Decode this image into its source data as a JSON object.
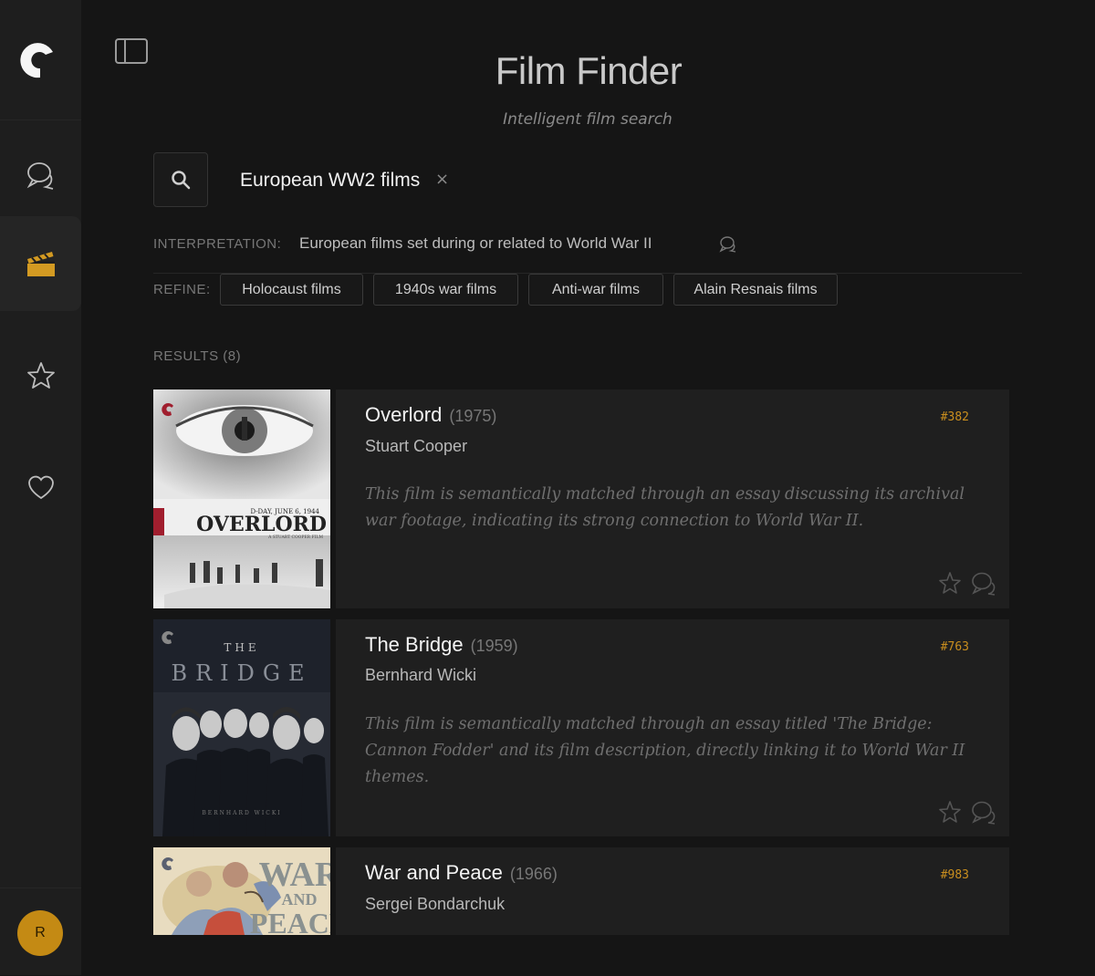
{
  "app": {
    "title": "Film Finder",
    "subtitle": "Intelligent film search"
  },
  "sidebar": {
    "logo": "criterion-c-logo",
    "items": [
      {
        "name": "chat",
        "icon": "chat-bubble-icon",
        "active": false
      },
      {
        "name": "films",
        "icon": "clapperboard-icon",
        "active": true
      },
      {
        "name": "favorites",
        "icon": "star-icon",
        "active": false
      },
      {
        "name": "liked",
        "icon": "heart-icon",
        "active": false
      }
    ],
    "avatar_initial": "R",
    "avatar_color": "#c48a14"
  },
  "search": {
    "query": "European WW2 films",
    "clear_symbol": "×"
  },
  "interpretation": {
    "label": "INTERPRETATION:",
    "text": "European films set during or related to World War II"
  },
  "refine": {
    "label": "REFINE:",
    "chips": [
      "Holocaust films",
      "1940s war films",
      "Anti-war films",
      "Alain Resnais films"
    ]
  },
  "results": {
    "label": "RESULTS (8)",
    "items": [
      {
        "title": "Overlord",
        "year": "(1975)",
        "director": "Stuart Cooper",
        "rank": "#382",
        "description": "This film is semantically matched through an essay discussing its archival war footage, indicating its strong connection to World War II.",
        "poster_text": "OVERLORD",
        "poster_tagline": "D-DAY, JUNE 6, 1944",
        "poster_credit": "A STUART COOPER FILM"
      },
      {
        "title": "The Bridge",
        "year": "(1959)",
        "director": "Bernhard Wicki",
        "rank": "#763",
        "description": "This film is semantically matched through an essay titled 'The Bridge: Cannon Fodder' and its film description, directly linking it to World War II themes.",
        "poster_the": "THE",
        "poster_text": "BRIDGE",
        "poster_credit": "BERNHARD WICKI"
      },
      {
        "title": "War and Peace",
        "year": "(1966)",
        "director": "Sergei Bondarchuk",
        "rank": "#983",
        "poster_text_1": "WAR",
        "poster_text_2": "AND",
        "poster_text_3": "PEACE"
      }
    ]
  },
  "colors": {
    "accent": "#c98e1e",
    "background": "#151515",
    "panel": "#1f1f1f"
  }
}
